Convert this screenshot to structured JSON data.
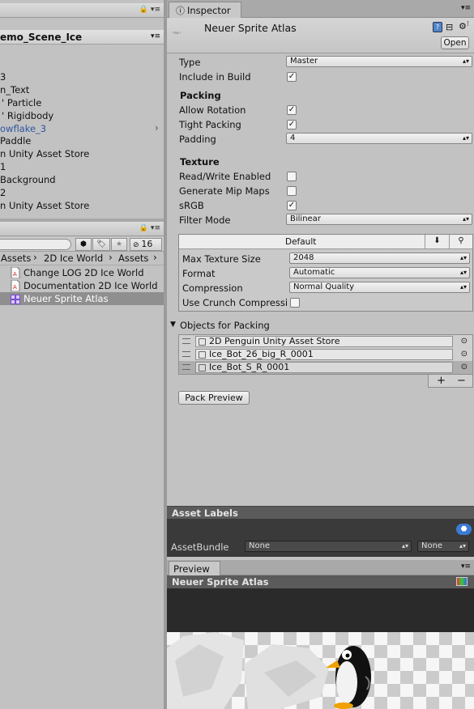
{
  "hierarchy": {
    "scene_name": "emo_Scene_Ice",
    "items": [
      "3",
      "n_Text",
      "' Particle",
      "' Rigidbody",
      "owflake_3",
      "Paddle",
      "n Unity Asset Store",
      "1",
      "Background",
      "2",
      "n Unity Asset Store"
    ]
  },
  "project": {
    "hidden_count": "16",
    "breadcrumbs": [
      "Assets",
      "2D Ice World",
      "Assets"
    ],
    "files": [
      "Change LOG 2D Ice World",
      "Documentation 2D Ice World",
      "Neuer Sprite Atlas"
    ]
  },
  "inspector": {
    "tab_label": "Inspector",
    "asset_name": "Neuer Sprite Atlas",
    "open_button": "Open",
    "type_label": "Type",
    "type_value": "Master",
    "include_label": "Include in Build",
    "packing_header": "Packing",
    "allow_rotation_label": "Allow Rotation",
    "tight_packing_label": "Tight Packing",
    "padding_label": "Padding",
    "padding_value": "4",
    "texture_header": "Texture",
    "readwrite_label": "Read/Write Enabled",
    "mipmaps_label": "Generate Mip Maps",
    "srgb_label": "sRGB",
    "filter_label": "Filter Mode",
    "filter_value": "Bilinear",
    "platform_tab": "Default",
    "max_size_label": "Max Texture Size",
    "max_size_value": "2048",
    "format_label": "Format",
    "format_value": "Automatic",
    "compression_label": "Compression",
    "compression_value": "Normal Quality",
    "crunch_label": "Use Crunch Compressi",
    "objects_header": "Objects for Packing",
    "objects": [
      "2D Penguin Unity Asset Store",
      "Ice_Bot_26_big_R_0001",
      "Ice_Bot_S_R_0001"
    ],
    "plus": "+",
    "minus": "−",
    "pack_preview_button": "Pack Preview",
    "asset_labels_header": "Asset Labels",
    "assetbundle_label": "AssetBundle",
    "assetbundle_value": "None",
    "assetbundle_variant": "None",
    "preview_tab": "Preview",
    "preview_title": "Neuer Sprite Atlas",
    "checkboxes": {
      "include": true,
      "rotation": true,
      "tight": true,
      "readwrite": false,
      "mipmaps": false,
      "srgb": true,
      "crunch": false
    }
  }
}
